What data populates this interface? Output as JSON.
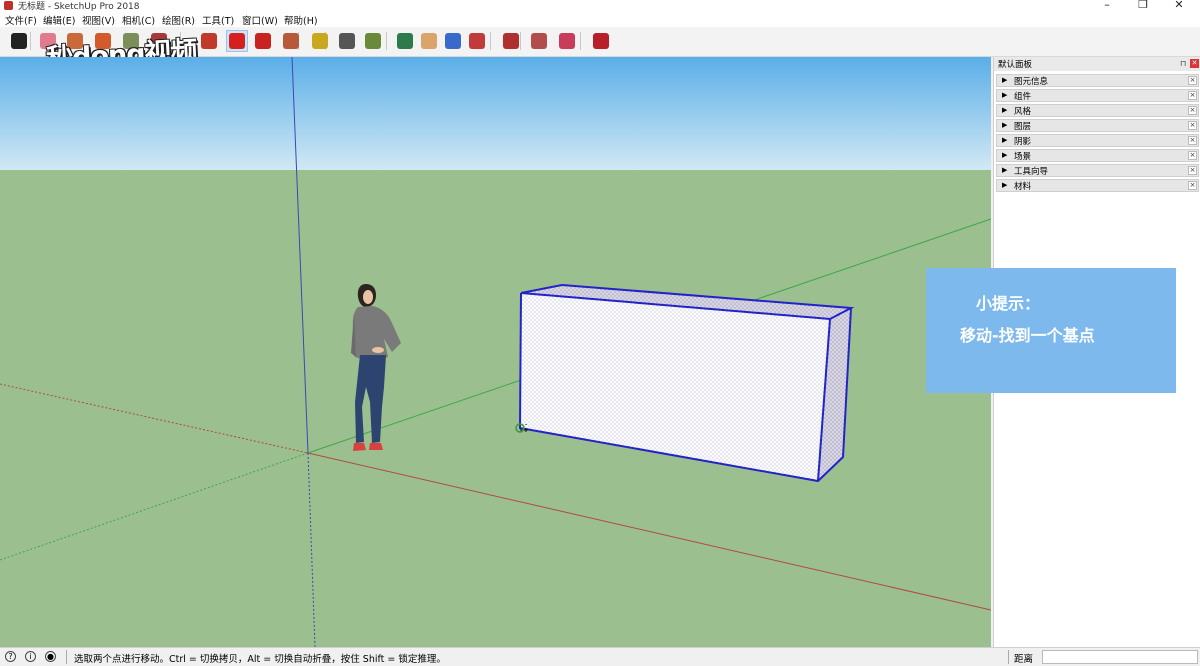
{
  "window": {
    "title": "无标题 - SketchUp Pro 2018"
  },
  "menu": [
    {
      "label": "文件(F)"
    },
    {
      "label": "编辑(E)"
    },
    {
      "label": "视图(V)"
    },
    {
      "label": "相机(C)"
    },
    {
      "label": "绘图(R)"
    },
    {
      "label": "工具(T)"
    },
    {
      "label": "窗口(W)"
    },
    {
      "label": "帮助(H)"
    }
  ],
  "toolbar": {
    "tools": [
      {
        "name": "select-tool-icon",
        "color": "#222222"
      },
      {
        "name": "eraser-tool-icon",
        "color": "#e07a8c"
      },
      {
        "name": "paint-tool-icon",
        "color": "#c96a3a"
      },
      {
        "name": "line-tool-icon",
        "color": "#d35b2b"
      },
      {
        "name": "shape-tool-icon",
        "color": "#7a8f5a"
      },
      {
        "name": "push-pull-tool-icon",
        "color": "#a63a3a"
      },
      {
        "name": "offset-tool-icon",
        "color": "#c0392b"
      },
      {
        "name": "move-tool-icon",
        "color": "#d62020"
      },
      {
        "name": "rotate-tool-icon",
        "color": "#c92222"
      },
      {
        "name": "scale-tool-icon",
        "color": "#b85a3a"
      },
      {
        "name": "tape-measure-tool-icon",
        "color": "#c9a820"
      },
      {
        "name": "text-tool-icon",
        "color": "#555555"
      },
      {
        "name": "paint-bucket-tool-icon",
        "color": "#6a8a3a"
      },
      {
        "name": "orbit-tool-icon",
        "color": "#2d7a4a"
      },
      {
        "name": "pan-tool-icon",
        "color": "#d9a56a"
      },
      {
        "name": "zoom-tool-icon",
        "color": "#3a6ac9"
      },
      {
        "name": "zoom-extents-tool-icon",
        "color": "#c23b3b"
      },
      {
        "name": "warehouse-icon",
        "color": "#b03030"
      },
      {
        "name": "extension-warehouse-icon",
        "color": "#b34d4d"
      },
      {
        "name": "send-to-layout-icon",
        "color": "#c93d5a"
      },
      {
        "name": "ruby-icon",
        "color": "#b81f2a"
      }
    ],
    "active_tool": "move-tool-icon"
  },
  "watermark": {
    "text": "秒dong视频"
  },
  "panel": {
    "title": "默认面板",
    "trays": [
      {
        "label": "图元信息"
      },
      {
        "label": "组件"
      },
      {
        "label": "风格"
      },
      {
        "label": "图层"
      },
      {
        "label": "阴影"
      },
      {
        "label": "场景"
      },
      {
        "label": "工具向导"
      },
      {
        "label": "材料"
      }
    ]
  },
  "tip": {
    "line1": "小提示：",
    "line2": "移动-找到一个基点"
  },
  "status": {
    "text": "选取两个点进行移动。Ctrl = 切换拷贝，Alt = 切换自动折叠，按住 Shift = 锁定推理。",
    "measure_label": "距离",
    "measure_value": ""
  },
  "colors": {
    "sky_top": "#5aaee8",
    "sky_bottom": "#d3e9f4",
    "ground": "#9cbf8f",
    "axis_red": "#b04a3f",
    "axis_green": "#3aa84a",
    "axis_blue": "#3a4ab0",
    "box_edge": "#2323c8",
    "tip_bg": "#7eb9ed"
  }
}
